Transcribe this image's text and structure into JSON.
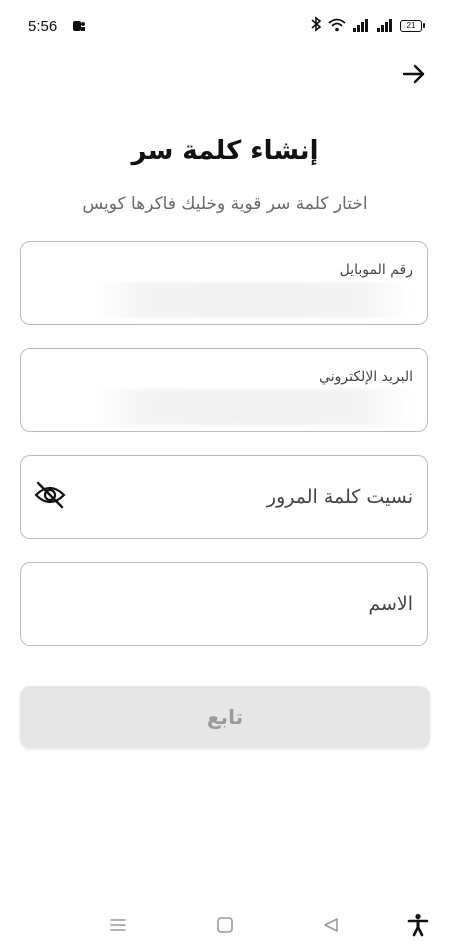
{
  "status_bar": {
    "time": "5:56",
    "battery": "21"
  },
  "header": {
    "back_icon": "arrow-right-icon"
  },
  "page": {
    "title": "إنشاء كلمة سر",
    "subtitle": "اختار كلمة سر قوية وخليك فاكرها كويس"
  },
  "form": {
    "phone": {
      "label": "رقم الموبايل"
    },
    "email": {
      "label": "البريد الإلكتروني"
    },
    "password": {
      "placeholder": "نسيت كلمة المرور",
      "toggle_icon": "eye-off-icon"
    },
    "name": {
      "placeholder": "الاسم"
    },
    "submit_label": "تابع"
  },
  "nav_bar": {
    "items": [
      "menu-icon",
      "home-square-icon",
      "back-triangle-icon",
      "accessibility-icon"
    ]
  }
}
